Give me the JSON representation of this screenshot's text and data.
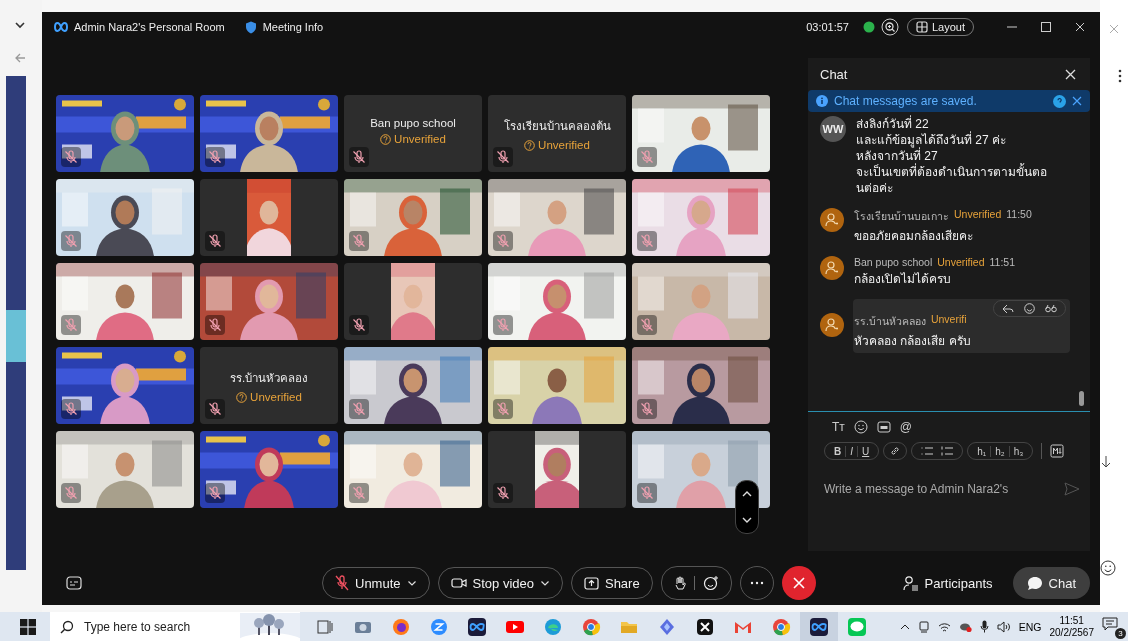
{
  "window": {
    "title": "Admin Nara2's Personal Room",
    "meeting_info": "Meeting Info",
    "timer": "03:01:57",
    "layout_button": "Layout"
  },
  "video_grid": {
    "tiles": [
      {
        "kind": "video",
        "muted": true
      },
      {
        "kind": "video",
        "muted": true
      },
      {
        "kind": "name",
        "name": "Ban pupo school",
        "status": "Unverified",
        "muted": true
      },
      {
        "kind": "name",
        "name": "โรงเรียนบ้านคลองต้น",
        "status": "Unverified",
        "muted": true
      },
      {
        "kind": "video",
        "muted": true
      },
      {
        "kind": "video",
        "muted": true
      },
      {
        "kind": "portrait_video",
        "muted": true
      },
      {
        "kind": "video",
        "muted": true
      },
      {
        "kind": "video",
        "muted": true
      },
      {
        "kind": "video",
        "muted": true
      },
      {
        "kind": "video",
        "muted": true
      },
      {
        "kind": "video",
        "muted": true
      },
      {
        "kind": "portrait_video",
        "muted": true
      },
      {
        "kind": "video",
        "muted": true
      },
      {
        "kind": "video",
        "muted": true
      },
      {
        "kind": "video",
        "muted": true
      },
      {
        "kind": "name",
        "name": "รร.บ้านหัวคลอง",
        "status": "Unverified",
        "muted": true
      },
      {
        "kind": "video",
        "muted": true
      },
      {
        "kind": "video",
        "muted": true
      },
      {
        "kind": "video",
        "muted": true
      },
      {
        "kind": "video",
        "muted": true
      },
      {
        "kind": "video",
        "muted": true
      },
      {
        "kind": "video",
        "muted": true
      },
      {
        "kind": "portrait_video",
        "muted": true
      },
      {
        "kind": "video",
        "muted": true
      }
    ]
  },
  "chat": {
    "title": "Chat",
    "banner": "Chat messages are saved.",
    "messages": [
      {
        "avatar": "WW",
        "lines": [
          "ส่งลิงก์วันที่ 22",
          "และแก้ข้อมูลได้ถึงวันที่ 27 ค่ะ",
          "หลังจากวันที่ 27",
          "จะเป็นเขตที่ต้องดำเนินการตามขั้นตอ",
          "นต่อค่ะ"
        ]
      },
      {
        "sender": "โรงเรียนบ้านบอเกาะ",
        "status": "Unverified",
        "time": "11:50",
        "lines": [
          "ขออภัยคอมกล้องเสียคะ"
        ],
        "hovered": false
      },
      {
        "sender": "Ban pupo school",
        "status": "Unverified",
        "time": "11:51",
        "lines": [
          "กล้องเปิดไม่ได้ครบ"
        ],
        "hovered": false
      },
      {
        "sender": "รร.บ้านหัวคลอง",
        "status": "Unverifi",
        "lines": [
          "หัวคลอง กล้องเสีย ครับ"
        ],
        "hovered": true
      }
    ],
    "composer": {
      "text_tools": [
        "Tт",
        "@"
      ],
      "format_buttons": [
        "B",
        "I",
        "U"
      ],
      "heading_buttons": [
        "h₁",
        "h₂",
        "h₃"
      ],
      "placeholder": "Write a message to Admin Nara2's"
    }
  },
  "toolbar": {
    "buttons": [
      {
        "kind": "mic",
        "label": "Unmute",
        "dropdown": true
      },
      {
        "kind": "camera",
        "label": "Stop video",
        "dropdown": true
      },
      {
        "kind": "share",
        "label": "Share",
        "dropdown": false
      }
    ],
    "panels": [
      {
        "kind": "participants",
        "label": "Participants",
        "selected": false
      },
      {
        "kind": "chat",
        "label": "Chat",
        "selected": true
      }
    ]
  },
  "taskbar": {
    "search_placeholder": "Type here to search",
    "language": "ENG",
    "time": "11:51",
    "date": "20/2/2567",
    "notifications": "3"
  }
}
